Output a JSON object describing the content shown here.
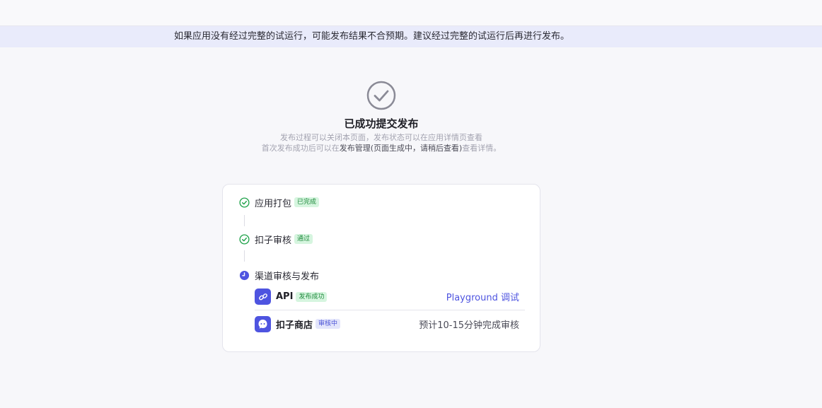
{
  "notice": {
    "text": "如果应用没有经过完整的试运行，可能发布结果不合预期。建议经过完整的试运行后再进行发布。"
  },
  "result": {
    "icon": "check-circle-icon",
    "title": "已成功提交发布",
    "subtitle_line1": "发布过程可以关闭本页面，发布状态可以在应用详情页查看",
    "subtitle_line2_prefix": "首次发布成功后可以在",
    "subtitle_line2_strong": "发布管理(页面生成中，请稍后查看)",
    "subtitle_line2_suffix": "查看详情。"
  },
  "steps": [
    {
      "label": "应用打包",
      "tag": "已完成",
      "status": "done",
      "icon": "check-circle-icon"
    },
    {
      "label": "扣子审核",
      "tag": "通过",
      "status": "done",
      "icon": "check-circle-icon"
    },
    {
      "label": "渠道审核与发布",
      "status": "in-progress",
      "icon": "clock-icon"
    }
  ],
  "channels": [
    {
      "name": "API",
      "tag": "发布成功",
      "right": "Playground 调试",
      "icon": "link-icon"
    },
    {
      "name": "扣子商店",
      "tag": "审核中",
      "right": "预计10-15分钟完成审核",
      "icon": "store-mascot-icon"
    }
  ],
  "colors": {
    "accent": "#4e54e0",
    "success": "#1f8a3c",
    "notice_bg": "#e9ebfb"
  }
}
